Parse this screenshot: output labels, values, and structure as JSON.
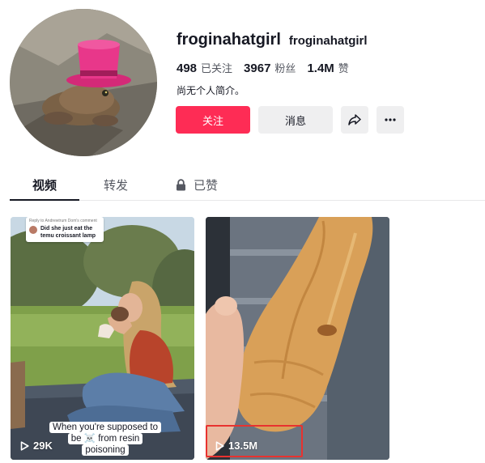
{
  "profile": {
    "username": "froginahatgirl",
    "nickname": "froginahatgirl",
    "avatar_icon": "frog-with-pink-top-hat",
    "stats": [
      {
        "value": "498",
        "label": "已关注"
      },
      {
        "value": "3967",
        "label": "粉丝"
      },
      {
        "value": "1.4M",
        "label": "赞"
      }
    ],
    "bio": "尚无个人简介。"
  },
  "actions": {
    "follow_label": "关注",
    "message_label": "消息",
    "share_icon": "share-arrow-icon",
    "more_icon": "more-dots-icon"
  },
  "tabs": {
    "videos": "视频",
    "reposts": "转发",
    "liked": "已赞",
    "liked_icon": "lock-icon"
  },
  "videos": [
    {
      "reply_header": "Reply to Andrewtrum Dom's comment",
      "reply_text": "Did she just eat the temu croissant lamp",
      "caption": "When you're supposed to be ☠️ from resin poisoning",
      "views": "29K"
    },
    {
      "views": "13.5M"
    }
  ],
  "colors": {
    "accent": "#fe2c55",
    "secondary_button": "#efeff0",
    "text": "#161823",
    "muted_text": "#555861",
    "highlight": "#e8322f"
  }
}
